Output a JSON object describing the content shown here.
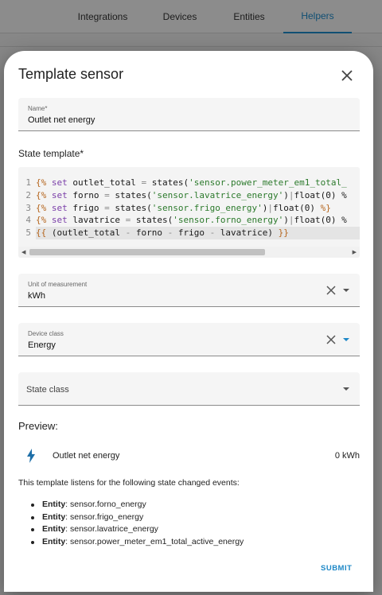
{
  "background": {
    "tabs": [
      {
        "label": "Integrations",
        "active": false
      },
      {
        "label": "Devices",
        "active": false
      },
      {
        "label": "Entities",
        "active": false
      },
      {
        "label": "Helpers",
        "active": true
      }
    ],
    "accent": "#1e88c7"
  },
  "dialog": {
    "title": "Template sensor",
    "name_field": {
      "label": "Name*",
      "value": "Outlet net energy"
    },
    "state_template_label": "State template*",
    "code": {
      "line_numbers": [
        "1",
        "2",
        "3",
        "4",
        "5"
      ],
      "lines": [
        "{% set outlet_total = states('sensor.power_meter_em1_total_",
        "{% set forno = states('sensor.lavatrice_energy')|float(0) %",
        "{% set frigo = states('sensor.frigo_energy')|float(0) %}",
        "{% set lavatrice = states('sensor.forno_energy')|float(0) %",
        "{{ (outlet_total - forno - frigo - lavatrice) }}"
      ]
    },
    "unit_field": {
      "label": "Unit of measurement",
      "value": "kWh"
    },
    "device_class_field": {
      "label": "Device class",
      "value": "Energy"
    },
    "state_class_field": {
      "placeholder": "State class"
    },
    "preview": {
      "title": "Preview:",
      "entity_name": "Outlet net energy",
      "value": "0 kWh",
      "icon": "lightning-bolt-icon"
    },
    "listens_text": "This template listens for the following state changed events:",
    "entities": [
      {
        "prefix": "Entity",
        "id": ": sensor.forno_energy"
      },
      {
        "prefix": "Entity",
        "id": ": sensor.frigo_energy"
      },
      {
        "prefix": "Entity",
        "id": ": sensor.lavatrice_energy"
      },
      {
        "prefix": "Entity",
        "id": ": sensor.power_meter_em1_total_active_energy"
      }
    ],
    "submit_label": "SUBMIT"
  }
}
